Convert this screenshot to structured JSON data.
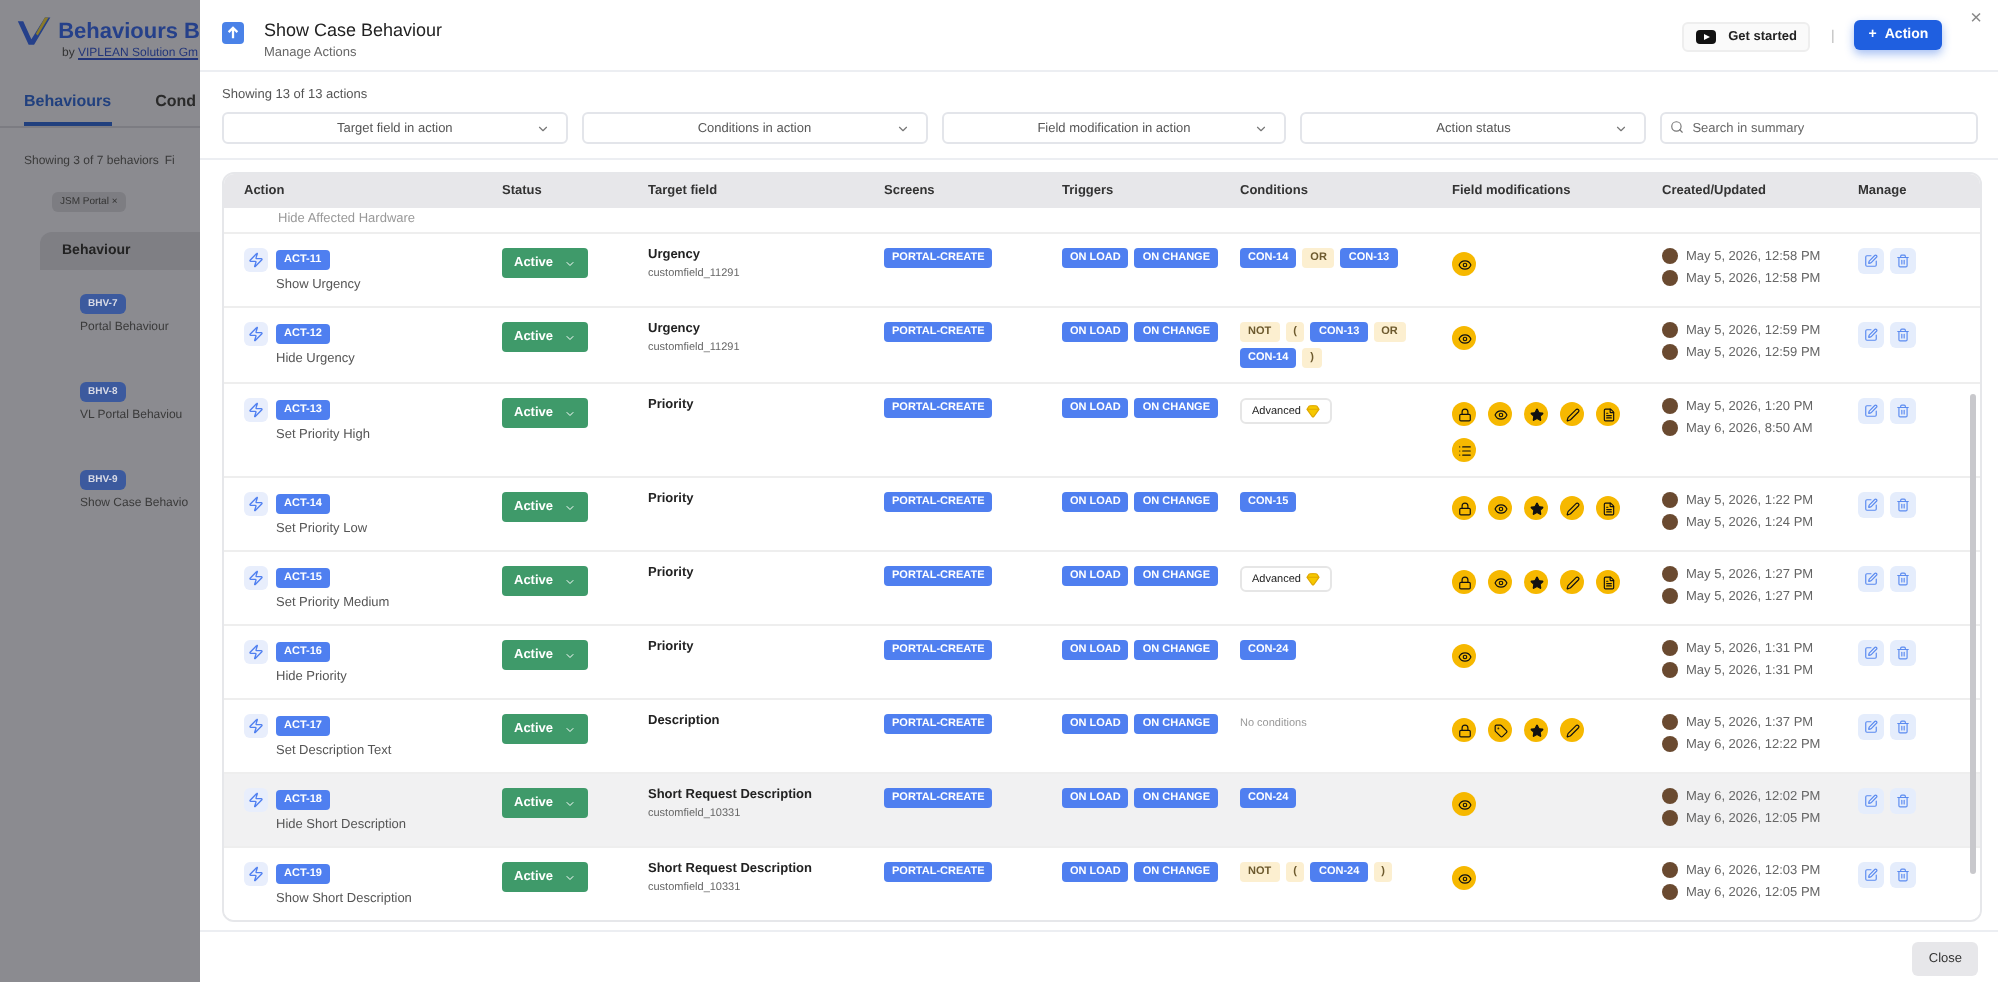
{
  "background_page": {
    "logo_text": "Behaviours B",
    "byline_prefix": "by",
    "byline_link": "VIPLEAN Solution Gm",
    "tabs": [
      {
        "label": "Behaviours",
        "selected": true
      },
      {
        "label": "Cond",
        "selected": false
      }
    ],
    "summary": "Showing 3 of 7 behaviors",
    "summary_link": "Fi",
    "filter_chip": "JSM Portal",
    "filter_chip_remove": "×",
    "column": "Behaviour",
    "rows": [
      {
        "id": "BHV-7",
        "name": "Portal Behaviour"
      },
      {
        "id": "BHV-8",
        "name": "VL Portal Behaviou"
      },
      {
        "id": "BHV-9",
        "name": "Show Case Behavio"
      }
    ]
  },
  "modal": {
    "title": "Show Case Behaviour",
    "subtitle": "Manage Actions",
    "get_started": "Get started",
    "separator": "|",
    "add_button": "Action",
    "add_symbol": "+",
    "close_symbol": "×",
    "summary": "Showing 13 of 13 actions",
    "filters": [
      {
        "placeholder": "Target field in action"
      },
      {
        "placeholder": "Conditions in action"
      },
      {
        "placeholder": "Field modification in action"
      },
      {
        "placeholder": "Action status"
      }
    ],
    "search": {
      "placeholder": "Search in summary"
    },
    "table": {
      "columns": [
        "Action",
        "Status",
        "Target field",
        "Screens",
        "Triggers",
        "Conditions",
        "Field modifications",
        "Created/Updated",
        "Manage"
      ],
      "partial_row": "Hide Affected Hardware",
      "rows": [
        {
          "id": "ACT-11",
          "name": "Show Urgency",
          "status": "Active",
          "target": "Urgency",
          "target_key": "customfield_11291",
          "screens": [
            "PORTAL-CREATE"
          ],
          "triggers": [
            "ON LOAD",
            "ON CHANGE"
          ],
          "conditions": [
            {
              "kind": "con",
              "text": "CON-14"
            },
            {
              "kind": "op",
              "text": "OR"
            },
            {
              "kind": "con",
              "text": "CON-13"
            }
          ],
          "modifications": [
            {
              "kind": "eye"
            }
          ],
          "created": "May 5, 2026, 12:58 PM",
          "updated": "May 5, 2026, 12:58 PM",
          "highlighted": false
        },
        {
          "id": "ACT-12",
          "name": "Hide Urgency",
          "status": "Active",
          "target": "Urgency",
          "target_key": "customfield_11291",
          "screens": [
            "PORTAL-CREATE"
          ],
          "triggers": [
            "ON LOAD",
            "ON CHANGE"
          ],
          "conditions": [
            {
              "kind": "op",
              "text": "NOT"
            },
            {
              "kind": "op",
              "text": "("
            },
            {
              "kind": "con",
              "text": "CON-13"
            },
            {
              "kind": "op",
              "text": "OR"
            },
            {
              "kind": "con",
              "text": "CON-14"
            },
            {
              "kind": "op",
              "text": ")"
            }
          ],
          "modifications": [
            {
              "kind": "eye"
            }
          ],
          "created": "May 5, 2026, 12:59 PM",
          "updated": "May 5, 2026, 12:59 PM",
          "highlighted": false
        },
        {
          "id": "ACT-13",
          "name": "Set Priority High",
          "status": "Active",
          "target": "Priority",
          "screens": [
            "PORTAL-CREATE"
          ],
          "triggers": [
            "ON LOAD",
            "ON CHANGE"
          ],
          "conditions": [
            {
              "kind": "advanced",
              "text": "Advanced"
            }
          ],
          "modifications": [
            {
              "kind": "lock"
            },
            {
              "kind": "eye"
            },
            {
              "kind": "star"
            },
            {
              "kind": "pen"
            },
            {
              "kind": "doc"
            },
            {
              "kind": "list"
            }
          ],
          "created": "May 5, 2026, 1:20 PM",
          "updated": "May 6, 2026, 8:50 AM",
          "highlighted": false
        },
        {
          "id": "ACT-14",
          "name": "Set Priority Low",
          "status": "Active",
          "target": "Priority",
          "screens": [
            "PORTAL-CREATE"
          ],
          "triggers": [
            "ON LOAD",
            "ON CHANGE"
          ],
          "conditions": [
            {
              "kind": "con",
              "text": "CON-15"
            }
          ],
          "modifications": [
            {
              "kind": "lock"
            },
            {
              "kind": "eye"
            },
            {
              "kind": "star"
            },
            {
              "kind": "pen"
            },
            {
              "kind": "doc"
            }
          ],
          "created": "May 5, 2026, 1:22 PM",
          "updated": "May 5, 2026, 1:24 PM",
          "highlighted": false
        },
        {
          "id": "ACT-15",
          "name": "Set Priority Medium",
          "status": "Active",
          "target": "Priority",
          "screens": [
            "PORTAL-CREATE"
          ],
          "triggers": [
            "ON LOAD",
            "ON CHANGE"
          ],
          "conditions": [
            {
              "kind": "advanced",
              "text": "Advanced"
            }
          ],
          "modifications": [
            {
              "kind": "lock"
            },
            {
              "kind": "eye"
            },
            {
              "kind": "star"
            },
            {
              "kind": "pen"
            },
            {
              "kind": "doc"
            }
          ],
          "created": "May 5, 2026, 1:27 PM",
          "updated": "May 5, 2026, 1:27 PM",
          "highlighted": false
        },
        {
          "id": "ACT-16",
          "name": "Hide Priority",
          "status": "Active",
          "target": "Priority",
          "screens": [
            "PORTAL-CREATE"
          ],
          "triggers": [
            "ON LOAD",
            "ON CHANGE"
          ],
          "conditions": [
            {
              "kind": "con",
              "text": "CON-24"
            }
          ],
          "modifications": [
            {
              "kind": "eye"
            }
          ],
          "created": "May 5, 2026, 1:31 PM",
          "updated": "May 5, 2026, 1:31 PM",
          "highlighted": false
        },
        {
          "id": "ACT-17",
          "name": "Set Description Text",
          "status": "Active",
          "target": "Description",
          "screens": [
            "PORTAL-CREATE"
          ],
          "triggers": [
            "ON LOAD",
            "ON CHANGE"
          ],
          "conditions": [
            {
              "kind": "none",
              "text": "No conditions"
            }
          ],
          "modifications": [
            {
              "kind": "lock"
            },
            {
              "kind": "tag"
            },
            {
              "kind": "star"
            },
            {
              "kind": "pen"
            }
          ],
          "created": "May 5, 2026, 1:37 PM",
          "updated": "May 6, 2026, 12:22 PM",
          "highlighted": false
        },
        {
          "id": "ACT-18",
          "name": "Hide Short Description",
          "status": "Active",
          "target": "Short Request Description",
          "target_key": "customfield_10331",
          "screens": [
            "PORTAL-CREATE"
          ],
          "triggers": [
            "ON LOAD",
            "ON CHANGE"
          ],
          "conditions": [
            {
              "kind": "con",
              "text": "CON-24"
            }
          ],
          "modifications": [
            {
              "kind": "eye"
            }
          ],
          "created": "May 6, 2026, 12:02 PM",
          "updated": "May 6, 2026, 12:05 PM",
          "highlighted": true
        },
        {
          "id": "ACT-19",
          "name": "Show Short Description",
          "status": "Active",
          "target": "Short Request Description",
          "target_key": "customfield_10331",
          "screens": [
            "PORTAL-CREATE"
          ],
          "triggers": [
            "ON LOAD",
            "ON CHANGE"
          ],
          "conditions": [
            {
              "kind": "op",
              "text": "NOT"
            },
            {
              "kind": "op",
              "text": "("
            },
            {
              "kind": "con",
              "text": "CON-24"
            },
            {
              "kind": "op",
              "text": ")"
            }
          ],
          "modifications": [
            {
              "kind": "eye"
            }
          ],
          "created": "May 6, 2026, 12:03 PM",
          "updated": "May 6, 2026, 12:05 PM",
          "highlighted": false
        }
      ]
    },
    "close_button": "Close"
  }
}
